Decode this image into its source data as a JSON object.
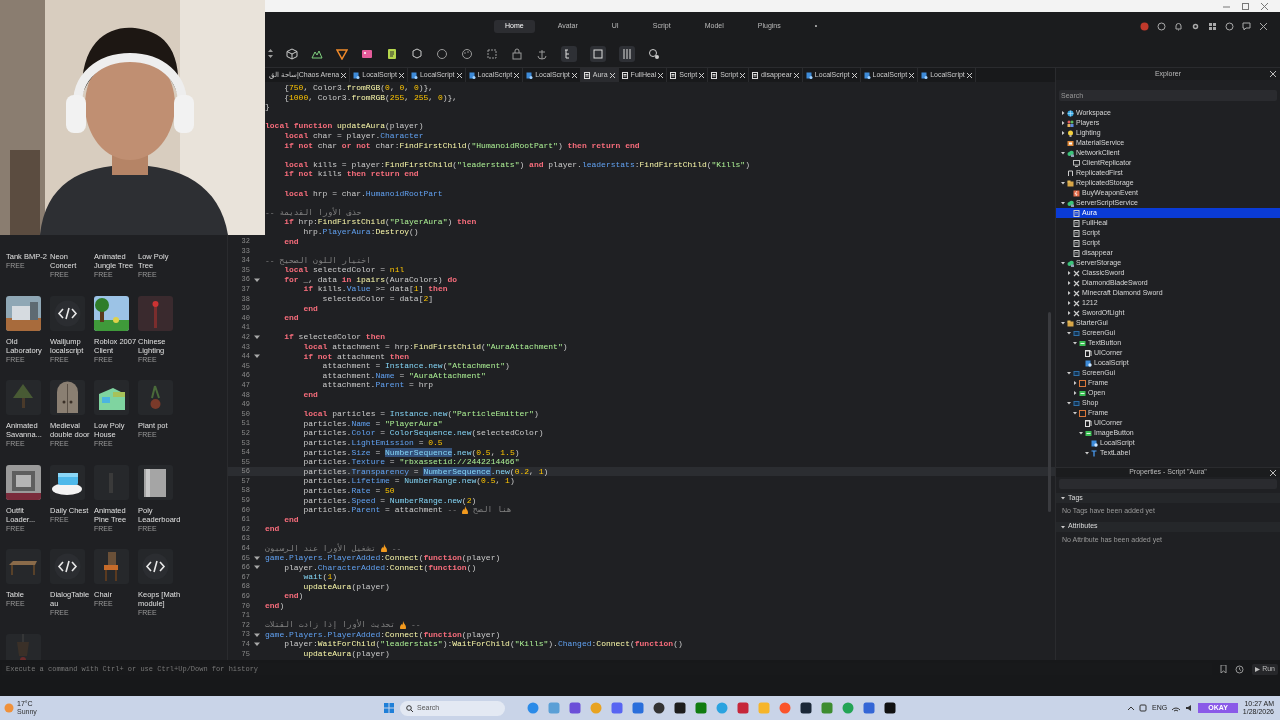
{
  "webcam": {
    "kind": "picture"
  },
  "menu_tabs": [
    {
      "label": "Home",
      "selected": true
    },
    {
      "label": "Avatar",
      "selected": false
    },
    {
      "label": "UI",
      "selected": false
    },
    {
      "label": "Script",
      "selected": false
    },
    {
      "label": "Model",
      "selected": false
    },
    {
      "label": "Plugins",
      "selected": false
    },
    {
      "label": "•",
      "selected": false
    }
  ],
  "script_tabs": [
    {
      "label": "ساحة الق|Chaos Arena",
      "kind": "place",
      "selected": false
    },
    {
      "label": "LocalScript",
      "kind": "localscript",
      "selected": false
    },
    {
      "label": "LocalScript",
      "kind": "localscript",
      "selected": false
    },
    {
      "label": "LocalScript",
      "kind": "localscript",
      "selected": false
    },
    {
      "label": "LocalScript",
      "kind": "localscript",
      "selected": false
    },
    {
      "label": "Aura",
      "kind": "script",
      "selected": true
    },
    {
      "label": "FullHeal",
      "kind": "script",
      "selected": false
    },
    {
      "label": "Script",
      "kind": "script",
      "selected": false
    },
    {
      "label": "Script",
      "kind": "script",
      "selected": false
    },
    {
      "label": "disappear",
      "kind": "script",
      "selected": false
    },
    {
      "label": "LocalScript",
      "kind": "localscript",
      "selected": false
    },
    {
      "label": "LocalScript",
      "kind": "localscript",
      "selected": false
    },
    {
      "label": "LocalScript",
      "kind": "localscript",
      "selected": false
    }
  ],
  "toolbox": {
    "items": [
      {
        "name": "Tank BMP-2",
        "price": "FREE"
      },
      {
        "name": "Neon Concert",
        "price": "FREE"
      },
      {
        "name": "Animated Jungle Tree",
        "price": "FREE"
      },
      {
        "name": "Low Poly Tree",
        "price": "FREE"
      },
      {
        "name": "Old Laboratory",
        "price": "FREE",
        "kind": "picture"
      },
      {
        "name": "Walljump localscript",
        "price": "FREE",
        "kind": "script"
      },
      {
        "name": "Roblox 2007 Client",
        "price": "FREE",
        "kind": "picture"
      },
      {
        "name": "Chinese Lighting",
        "price": "FREE",
        "kind": "picture"
      },
      {
        "name": "Animated Savanna...",
        "price": "FREE",
        "kind": "picture"
      },
      {
        "name": "Medieval double door",
        "price": "FREE",
        "kind": "picture"
      },
      {
        "name": "Low Poly House",
        "price": "FREE",
        "kind": "picture"
      },
      {
        "name": "Plant pot",
        "price": "FREE",
        "kind": "picture"
      },
      {
        "name": "Outfit Loader...",
        "price": "FREE",
        "kind": "picture"
      },
      {
        "name": "Daily Chest",
        "price": "FREE",
        "kind": "picture"
      },
      {
        "name": "Animated Pine Tree",
        "price": "FREE",
        "kind": "picture"
      },
      {
        "name": "Poly Leaderboard",
        "price": "FREE",
        "kind": "picture"
      },
      {
        "name": "Table",
        "price": "FREE",
        "kind": "picture"
      },
      {
        "name": "DialogTableau",
        "price": "FREE",
        "kind": "script"
      },
      {
        "name": "Chair",
        "price": "FREE",
        "kind": "picture"
      },
      {
        "name": "Keops [Math module]",
        "price": "FREE",
        "kind": "script"
      },
      {
        "kind": "picture"
      }
    ]
  },
  "editor": {
    "lines": [
      {
        "kind": "code",
        "segs": [
          {
            "kind": "plain",
            "text": "    {"
          },
          {
            "kind": "num",
            "text": "750"
          },
          {
            "kind": "plain",
            "text": ", Color3."
          },
          {
            "kind": "fn",
            "text": "fromRGB"
          },
          {
            "kind": "plain",
            "text": "("
          },
          {
            "kind": "num",
            "text": "0"
          },
          {
            "kind": "plain",
            "text": ", "
          },
          {
            "kind": "num",
            "text": "0"
          },
          {
            "kind": "plain",
            "text": ", "
          },
          {
            "kind": "num",
            "text": "0"
          },
          {
            "kind": "plain",
            "text": ")},"
          }
        ]
      },
      {
        "kind": "code",
        "segs": [
          {
            "kind": "plain",
            "text": "    {"
          },
          {
            "kind": "num",
            "text": "1000"
          },
          {
            "kind": "plain",
            "text": ", Color3."
          },
          {
            "kind": "fn",
            "text": "fromRGB"
          },
          {
            "kind": "plain",
            "text": "("
          },
          {
            "kind": "num",
            "text": "255"
          },
          {
            "kind": "plain",
            "text": ", "
          },
          {
            "kind": "num",
            "text": "255"
          },
          {
            "kind": "plain",
            "text": ", "
          },
          {
            "kind": "num",
            "text": "0"
          },
          {
            "kind": "plain",
            "text": ")},"
          }
        ]
      },
      {
        "kind": "code",
        "segs": [
          {
            "kind": "plain",
            "text": "}"
          }
        ]
      },
      {
        "kind": "blank"
      },
      {
        "kind": "code",
        "segs": [
          {
            "kind": "kw",
            "text": "local function "
          },
          {
            "kind": "fn",
            "text": "updateAura"
          },
          {
            "kind": "plain",
            "text": "(player)"
          }
        ]
      },
      {
        "kind": "code",
        "segs": [
          {
            "kind": "kw",
            "text": "    local "
          },
          {
            "kind": "plain",
            "text": "char = player."
          },
          {
            "kind": "prop",
            "text": "Character"
          }
        ]
      },
      {
        "kind": "code",
        "segs": [
          {
            "kind": "kw",
            "text": "    if not "
          },
          {
            "kind": "plain",
            "text": "char "
          },
          {
            "kind": "kw",
            "text": "or not "
          },
          {
            "kind": "plain",
            "text": "char:"
          },
          {
            "kind": "fn",
            "text": "FindFirstChild"
          },
          {
            "kind": "plain",
            "text": "("
          },
          {
            "kind": "str",
            "text": "\"HumanoidRootPart\""
          },
          {
            "kind": "plain",
            "text": ") "
          },
          {
            "kind": "kw",
            "text": "then return end"
          }
        ]
      },
      {
        "kind": "blank"
      },
      {
        "kind": "code",
        "segs": [
          {
            "kind": "kw",
            "text": "    local "
          },
          {
            "kind": "plain",
            "text": "kills = player:"
          },
          {
            "kind": "fn",
            "text": "FindFirstChild"
          },
          {
            "kind": "plain",
            "text": "("
          },
          {
            "kind": "str",
            "text": "\"leaderstats\""
          },
          {
            "kind": "plain",
            "text": ") "
          },
          {
            "kind": "kw",
            "text": "and "
          },
          {
            "kind": "plain",
            "text": "player."
          },
          {
            "kind": "prop",
            "text": "leaderstats"
          },
          {
            "kind": "plain",
            "text": ":"
          },
          {
            "kind": "fn",
            "text": "FindFirstChild"
          },
          {
            "kind": "plain",
            "text": "("
          },
          {
            "kind": "str",
            "text": "\"Kills\""
          },
          {
            "kind": "plain",
            "text": ")"
          }
        ]
      },
      {
        "kind": "code",
        "segs": [
          {
            "kind": "kw",
            "text": "    if not "
          },
          {
            "kind": "plain",
            "text": "kills "
          },
          {
            "kind": "kw",
            "text": "then return end"
          }
        ]
      },
      {
        "kind": "blank"
      },
      {
        "kind": "code",
        "segs": [
          {
            "kind": "kw",
            "text": "    local "
          },
          {
            "kind": "plain",
            "text": "hrp = char."
          },
          {
            "kind": "prop",
            "text": "HumanoidRootPart"
          }
        ]
      },
      {
        "kind": "blank"
      },
      {
        "kind": "code",
        "segs": [
          {
            "kind": "cm",
            "text": "حذف الأورا القديمة --"
          }
        ]
      },
      {
        "kind": "code",
        "segs": [
          {
            "kind": "kw",
            "text": "    if "
          },
          {
            "kind": "plain",
            "text": "hrp:"
          },
          {
            "kind": "fn",
            "text": "FindFirstChild"
          },
          {
            "kind": "plain",
            "text": "("
          },
          {
            "kind": "str",
            "text": "\"PlayerAura\""
          },
          {
            "kind": "plain",
            "text": ") "
          },
          {
            "kind": "kw",
            "text": "then"
          }
        ]
      },
      {
        "kind": "code",
        "segs": [
          {
            "kind": "plain",
            "text": "        hrp."
          },
          {
            "kind": "prop",
            "text": "PlayerAura"
          },
          {
            "kind": "plain",
            "text": ":"
          },
          {
            "kind": "fn",
            "text": "Destroy"
          },
          {
            "kind": "plain",
            "text": "()"
          }
        ]
      },
      {
        "number": "32",
        "kind": "code",
        "segs": [
          {
            "kind": "kw",
            "text": "    end"
          }
        ]
      },
      {
        "number": "33",
        "kind": "blank"
      },
      {
        "number": "34",
        "kind": "code",
        "segs": [
          {
            "kind": "cm",
            "text": "اختيار اللون الصحيح --"
          }
        ]
      },
      {
        "number": "35",
        "kind": "code",
        "segs": [
          {
            "kind": "kw",
            "text": "    local "
          },
          {
            "kind": "plain",
            "text": "selectedColor = "
          },
          {
            "kind": "num",
            "text": "nil"
          }
        ]
      },
      {
        "number": "36",
        "kind": "code",
        "fold": true,
        "segs": [
          {
            "kind": "kw",
            "text": "    for "
          },
          {
            "kind": "plain",
            "text": "_, data "
          },
          {
            "kind": "kw",
            "text": "in "
          },
          {
            "kind": "fn",
            "text": "ipairs"
          },
          {
            "kind": "plain",
            "text": "(AuraColors) "
          },
          {
            "kind": "kw",
            "text": "do"
          }
        ]
      },
      {
        "number": "37",
        "kind": "code",
        "segs": [
          {
            "kind": "kw",
            "text": "        if "
          },
          {
            "kind": "plain",
            "text": "kills."
          },
          {
            "kind": "prop",
            "text": "Value"
          },
          {
            "kind": "plain",
            "text": " >= data["
          },
          {
            "kind": "num",
            "text": "1"
          },
          {
            "kind": "plain",
            "text": "] "
          },
          {
            "kind": "kw",
            "text": "then"
          }
        ]
      },
      {
        "number": "38",
        "kind": "code",
        "segs": [
          {
            "kind": "plain",
            "text": "            selectedColor = data["
          },
          {
            "kind": "num",
            "text": "2"
          },
          {
            "kind": "plain",
            "text": "]"
          }
        ]
      },
      {
        "number": "39",
        "kind": "code",
        "segs": [
          {
            "kind": "kw",
            "text": "        end"
          }
        ]
      },
      {
        "number": "40",
        "kind": "code",
        "segs": [
          {
            "kind": "kw",
            "text": "    end"
          }
        ]
      },
      {
        "number": "41",
        "kind": "blank"
      },
      {
        "number": "42",
        "kind": "code",
        "fold": true,
        "segs": [
          {
            "kind": "kw",
            "text": "    if "
          },
          {
            "kind": "plain",
            "text": "selectedColor "
          },
          {
            "kind": "kw",
            "text": "then"
          }
        ]
      },
      {
        "number": "43",
        "kind": "code",
        "segs": [
          {
            "kind": "kw",
            "text": "        local "
          },
          {
            "kind": "plain",
            "text": "attachment = hrp:"
          },
          {
            "kind": "fn",
            "text": "FindFirstChild"
          },
          {
            "kind": "plain",
            "text": "("
          },
          {
            "kind": "str",
            "text": "\"AuraAttachment\""
          },
          {
            "kind": "plain",
            "text": ")"
          }
        ]
      },
      {
        "number": "44",
        "kind": "code",
        "fold": true,
        "segs": [
          {
            "kind": "kw",
            "text": "        if not "
          },
          {
            "kind": "plain",
            "text": "attachment "
          },
          {
            "kind": "kw",
            "text": "then"
          }
        ]
      },
      {
        "number": "45",
        "kind": "code",
        "segs": [
          {
            "kind": "plain",
            "text": "            attachment = "
          },
          {
            "kind": "type",
            "text": "Instance.new"
          },
          {
            "kind": "plain",
            "text": "("
          },
          {
            "kind": "str",
            "text": "\"Attachment\""
          },
          {
            "kind": "plain",
            "text": ")"
          }
        ]
      },
      {
        "number": "46",
        "kind": "code",
        "segs": [
          {
            "kind": "plain",
            "text": "            attachment."
          },
          {
            "kind": "prop",
            "text": "Name"
          },
          {
            "kind": "plain",
            "text": " = "
          },
          {
            "kind": "str",
            "text": "\"AuraAttachment\""
          }
        ]
      },
      {
        "number": "47",
        "kind": "code",
        "segs": [
          {
            "kind": "plain",
            "text": "            attachment."
          },
          {
            "kind": "prop",
            "text": "Parent"
          },
          {
            "kind": "plain",
            "text": " = hrp"
          }
        ]
      },
      {
        "number": "48",
        "kind": "code",
        "segs": [
          {
            "kind": "kw",
            "text": "        end"
          }
        ]
      },
      {
        "number": "49",
        "kind": "blank"
      },
      {
        "number": "50",
        "kind": "code",
        "segs": [
          {
            "kind": "kw",
            "text": "        local "
          },
          {
            "kind": "plain",
            "text": "particles = "
          },
          {
            "kind": "type",
            "text": "Instance.new"
          },
          {
            "kind": "plain",
            "text": "("
          },
          {
            "kind": "str",
            "text": "\"ParticleEmitter\""
          },
          {
            "kind": "plain",
            "text": ")"
          }
        ]
      },
      {
        "number": "51",
        "kind": "code",
        "segs": [
          {
            "kind": "plain",
            "text": "        particles."
          },
          {
            "kind": "prop",
            "text": "Name"
          },
          {
            "kind": "plain",
            "text": " = "
          },
          {
            "kind": "str",
            "text": "\"PlayerAura\""
          }
        ]
      },
      {
        "number": "52",
        "kind": "code",
        "segs": [
          {
            "kind": "plain",
            "text": "        particles."
          },
          {
            "kind": "prop",
            "text": "Color"
          },
          {
            "kind": "plain",
            "text": " = "
          },
          {
            "kind": "type",
            "text": "ColorSequence.new"
          },
          {
            "kind": "plain",
            "text": "(selectedColor)"
          }
        ]
      },
      {
        "number": "53",
        "kind": "code",
        "segs": [
          {
            "kind": "plain",
            "text": "        particles."
          },
          {
            "kind": "prop",
            "text": "LightEmission"
          },
          {
            "kind": "plain",
            "text": " = "
          },
          {
            "kind": "num",
            "text": "0.5"
          }
        ]
      },
      {
        "number": "54",
        "kind": "code",
        "segs": [
          {
            "kind": "plain",
            "text": "        particles."
          },
          {
            "kind": "prop",
            "text": "Size"
          },
          {
            "kind": "plain",
            "text": " = "
          },
          {
            "kind": "type",
            "text": "NumberSequence",
            "highlighted": true
          },
          {
            "kind": "type",
            "text": ".new"
          },
          {
            "kind": "plain",
            "text": "("
          },
          {
            "kind": "num",
            "text": "0.5"
          },
          {
            "kind": "plain",
            "text": ", "
          },
          {
            "kind": "num",
            "text": "1.5"
          },
          {
            "kind": "plain",
            "text": ")"
          }
        ]
      },
      {
        "number": "55",
        "kind": "code",
        "segs": [
          {
            "kind": "plain",
            "text": "        particles."
          },
          {
            "kind": "prop",
            "text": "Texture"
          },
          {
            "kind": "plain",
            "text": " = "
          },
          {
            "kind": "str",
            "text": "\"rbxassetid://2442214466\""
          }
        ]
      },
      {
        "number": "56",
        "kind": "code",
        "current": true,
        "segs": [
          {
            "kind": "plain",
            "text": "        particles."
          },
          {
            "kind": "prop",
            "text": "Transparency"
          },
          {
            "kind": "plain",
            "text": " = "
          },
          {
            "kind": "type",
            "text": "NumberSequence",
            "highlighted": true
          },
          {
            "kind": "type",
            "text": ".new"
          },
          {
            "kind": "plain",
            "text": "("
          },
          {
            "kind": "num",
            "text": "0.2"
          },
          {
            "kind": "plain",
            "text": ", "
          },
          {
            "kind": "num",
            "text": "1"
          },
          {
            "kind": "plain",
            "text": ")"
          }
        ]
      },
      {
        "number": "57",
        "kind": "code",
        "segs": [
          {
            "kind": "plain",
            "text": "        particles."
          },
          {
            "kind": "prop",
            "text": "Lifetime"
          },
          {
            "kind": "plain",
            "text": " = "
          },
          {
            "kind": "type",
            "text": "NumberRange.new"
          },
          {
            "kind": "plain",
            "text": "("
          },
          {
            "kind": "num",
            "text": "0.5"
          },
          {
            "kind": "plain",
            "text": ", "
          },
          {
            "kind": "num",
            "text": "1"
          },
          {
            "kind": "plain",
            "text": ")"
          }
        ]
      },
      {
        "number": "58",
        "kind": "code",
        "segs": [
          {
            "kind": "plain",
            "text": "        particles."
          },
          {
            "kind": "prop",
            "text": "Rate"
          },
          {
            "kind": "plain",
            "text": " = "
          },
          {
            "kind": "num",
            "text": "50"
          }
        ]
      },
      {
        "number": "59",
        "kind": "code",
        "segs": [
          {
            "kind": "plain",
            "text": "        particles."
          },
          {
            "kind": "prop",
            "text": "Speed"
          },
          {
            "kind": "plain",
            "text": " = "
          },
          {
            "kind": "type",
            "text": "NumberRange.new"
          },
          {
            "kind": "plain",
            "text": "("
          },
          {
            "kind": "num",
            "text": "2"
          },
          {
            "kind": "plain",
            "text": ")"
          }
        ]
      },
      {
        "number": "60",
        "kind": "code",
        "segs": [
          {
            "kind": "plain",
            "text": "        particles."
          },
          {
            "kind": "prop",
            "text": "Parent"
          },
          {
            "kind": "plain",
            "text": " = attachment "
          },
          {
            "kind": "cm",
            "text": "--"
          },
          {
            "kind": "fire"
          },
          {
            "kind": "cm",
            "text": "هنا الصح"
          }
        ]
      },
      {
        "number": "61",
        "kind": "code",
        "segs": [
          {
            "kind": "kw",
            "text": "    end"
          }
        ]
      },
      {
        "number": "62",
        "kind": "code",
        "segs": [
          {
            "kind": "kw",
            "text": "end"
          }
        ]
      },
      {
        "number": "63",
        "kind": "blank"
      },
      {
        "number": "64",
        "kind": "code",
        "segs": [
          {
            "kind": "cm",
            "text": "تشغيل الأورا عند الرسبون"
          },
          {
            "kind": "fire"
          },
          {
            "kind": "cm",
            "text": "--"
          }
        ]
      },
      {
        "number": "65",
        "kind": "code",
        "fold": true,
        "segs": [
          {
            "kind": "prop",
            "text": "game.Players.PlayerAdded"
          },
          {
            "kind": "plain",
            "text": ":"
          },
          {
            "kind": "fn",
            "text": "Connect"
          },
          {
            "kind": "plain",
            "text": "("
          },
          {
            "kind": "kw",
            "text": "function"
          },
          {
            "kind": "plain",
            "text": "(player)"
          }
        ]
      },
      {
        "number": "66",
        "kind": "code",
        "fold": true,
        "segs": [
          {
            "kind": "plain",
            "text": "    player."
          },
          {
            "kind": "prop",
            "text": "CharacterAdded"
          },
          {
            "kind": "plain",
            "text": ":"
          },
          {
            "kind": "fn",
            "text": "Connect"
          },
          {
            "kind": "plain",
            "text": "("
          },
          {
            "kind": "kw",
            "text": "function"
          },
          {
            "kind": "plain",
            "text": "()"
          }
        ]
      },
      {
        "number": "67",
        "kind": "code",
        "segs": [
          {
            "kind": "type",
            "text": "        wait"
          },
          {
            "kind": "plain",
            "text": "("
          },
          {
            "kind": "num",
            "text": "1"
          },
          {
            "kind": "plain",
            "text": ")"
          }
        ]
      },
      {
        "number": "68",
        "kind": "code",
        "segs": [
          {
            "kind": "fn",
            "text": "        updateAura"
          },
          {
            "kind": "plain",
            "text": "(player)"
          }
        ]
      },
      {
        "number": "69",
        "kind": "code",
        "segs": [
          {
            "kind": "kw",
            "text": "    end"
          },
          {
            "kind": "plain",
            "text": ")"
          }
        ]
      },
      {
        "number": "70",
        "kind": "code",
        "segs": [
          {
            "kind": "kw",
            "text": "end"
          },
          {
            "kind": "plain",
            "text": ")"
          }
        ]
      },
      {
        "number": "71",
        "kind": "blank"
      },
      {
        "number": "72",
        "kind": "code",
        "segs": [
          {
            "kind": "cm",
            "text": "تحديث الأورا إذا زادت القتلات"
          },
          {
            "kind": "fire"
          },
          {
            "kind": "cm",
            "text": "--"
          }
        ]
      },
      {
        "number": "73",
        "kind": "code",
        "fold": true,
        "segs": [
          {
            "kind": "prop",
            "text": "game.Players.PlayerAdded"
          },
          {
            "kind": "plain",
            "text": ":"
          },
          {
            "kind": "fn",
            "text": "Connect"
          },
          {
            "kind": "plain",
            "text": "("
          },
          {
            "kind": "kw",
            "text": "function"
          },
          {
            "kind": "plain",
            "text": "(player)"
          }
        ]
      },
      {
        "number": "74",
        "kind": "code",
        "fold": true,
        "segs": [
          {
            "kind": "plain",
            "text": "    player:"
          },
          {
            "kind": "fn",
            "text": "WaitForChild"
          },
          {
            "kind": "plain",
            "text": "("
          },
          {
            "kind": "str",
            "text": "\"leaderstats\""
          },
          {
            "kind": "plain",
            "text": "):"
          },
          {
            "kind": "fn",
            "text": "WaitForChild"
          },
          {
            "kind": "plain",
            "text": "("
          },
          {
            "kind": "str",
            "text": "\"Kills\""
          },
          {
            "kind": "plain",
            "text": ")."
          },
          {
            "kind": "prop",
            "text": "Changed"
          },
          {
            "kind": "plain",
            "text": ":"
          },
          {
            "kind": "fn",
            "text": "Connect"
          },
          {
            "kind": "plain",
            "text": "("
          },
          {
            "kind": "kw",
            "text": "function"
          },
          {
            "kind": "plain",
            "text": "()"
          }
        ]
      },
      {
        "number": "75",
        "kind": "code",
        "segs": [
          {
            "kind": "fn",
            "text": "        updateAura"
          },
          {
            "kind": "plain",
            "text": "(player)"
          }
        ]
      }
    ]
  },
  "explorer": {
    "title": "Explorer",
    "search_placeholder": "Search",
    "tree": [
      {
        "label": "Workspace",
        "kind": "workspace",
        "expanded": false,
        "selected": false
      },
      {
        "label": "Players",
        "kind": "players",
        "expanded": false,
        "selected": false
      },
      {
        "label": "Lighting",
        "kind": "lighting",
        "expanded": false,
        "selected": false
      },
      {
        "label": "MaterialService",
        "kind": "service",
        "selected": false
      },
      {
        "label": "NetworkClient",
        "kind": "network",
        "expanded": true,
        "selected": false,
        "children": [
          {
            "label": "ClientReplicator",
            "kind": "monitor",
            "selected": false
          }
        ]
      },
      {
        "label": "ReplicatedFirst",
        "kind": "replicated",
        "selected": false
      },
      {
        "label": "ReplicatedStorage",
        "kind": "storage",
        "expanded": true,
        "selected": false,
        "children": [
          {
            "label": "BuyWeaponEvent",
            "kind": "remote",
            "selected": false
          }
        ]
      },
      {
        "label": "ServerScriptService",
        "kind": "network",
        "expanded": true,
        "selected": false,
        "children": [
          {
            "label": "Aura",
            "kind": "script",
            "selected": true
          },
          {
            "label": "FullHeal",
            "kind": "script",
            "selected": false
          },
          {
            "label": "Script",
            "kind": "script",
            "selected": false
          },
          {
            "label": "Script",
            "kind": "script",
            "selected": false
          },
          {
            "label": "disappear",
            "kind": "script",
            "selected": false
          }
        ]
      },
      {
        "label": "ServerStorage",
        "kind": "network",
        "expanded": true,
        "selected": false,
        "children": [
          {
            "label": "ClassicSword",
            "kind": "tool",
            "expanded": false,
            "selected": false
          },
          {
            "label": "DiamondBladeSword",
            "kind": "tool",
            "expanded": false,
            "selected": false
          },
          {
            "label": "Minecraft Diamond Sword",
            "kind": "tool",
            "expanded": false,
            "selected": false
          },
          {
            "label": "1212",
            "kind": "tool",
            "expanded": false,
            "selected": false
          },
          {
            "label": "SwordOfLight",
            "kind": "tool",
            "expanded": false,
            "selected": false
          }
        ]
      },
      {
        "label": "StarterGui",
        "kind": "storage",
        "expanded": true,
        "selected": false,
        "children": [
          {
            "label": "ScreenGui",
            "kind": "gui",
            "expanded": true,
            "selected": false,
            "children": [
              {
                "label": "TextButton",
                "kind": "button",
                "expanded": true,
                "selected": false,
                "children": [
                  {
                    "label": "UICorner",
                    "kind": "corner",
                    "selected": false
                  },
                  {
                    "label": "LocalScript",
                    "kind": "localscript",
                    "selected": false
                  }
                ]
              }
            ]
          },
          {
            "label": "ScreenGui",
            "kind": "gui",
            "expanded": true,
            "selected": false,
            "children": [
              {
                "label": "Frame",
                "kind": "frame",
                "expanded": false,
                "selected": false
              },
              {
                "label": "Open",
                "kind": "button",
                "expanded": false,
                "selected": false
              }
            ]
          },
          {
            "label": "Shop",
            "kind": "gui",
            "expanded": true,
            "selected": false,
            "children": [
              {
                "label": "Frame",
                "kind": "frame",
                "expanded": true,
                "selected": false,
                "children": [
                  {
                    "label": "UICorner",
                    "kind": "corner",
                    "selected": false
                  },
                  {
                    "label": "ImageButton",
                    "kind": "button",
                    "expanded": true,
                    "selected": false,
                    "children": [
                      {
                        "label": "LocalScript",
                        "kind": "localscript",
                        "selected": false
                      },
                      {
                        "label": "TextLabel",
                        "kind": "label",
                        "expanded": true,
                        "selected": false
                      }
                    ]
                  }
                ]
              }
            ]
          }
        ]
      }
    ]
  },
  "properties": {
    "title": "Properties - Script \"Aura\"",
    "sections": [
      {
        "label": "Tags",
        "empty_text": "No Tags have been added yet",
        "expanded": true
      },
      {
        "label": "Attributes",
        "empty_text": "No Attribute has been added yet",
        "expanded": true
      }
    ]
  },
  "command_bar": {
    "placeholder": "Execute a command with Ctrl+ or use Ctrl+Up/Down for history",
    "run_label": "Run"
  },
  "taskbar": {
    "temperature": "17°C",
    "weather": "Sunny",
    "search_placeholder": "Search",
    "language": "ENG",
    "banner": "OKAY",
    "time": "10:27 AM",
    "date": "1/28/2026"
  }
}
